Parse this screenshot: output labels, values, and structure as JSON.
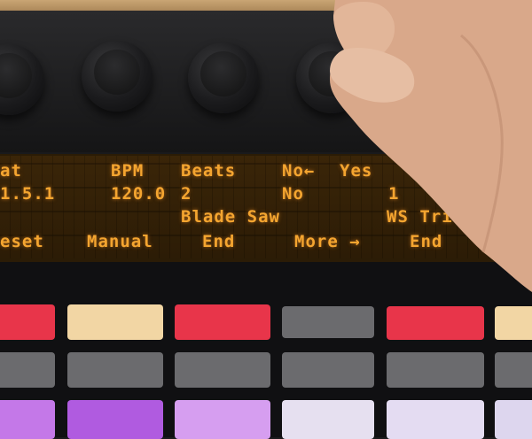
{
  "display": {
    "row1": {
      "c1": "at",
      "c2": "BPM",
      "c3": "Beats",
      "c4": "No←",
      "c5": "Yes"
    },
    "row2": {
      "c1": "1.5.1",
      "c2": "120.0",
      "c3": "2",
      "c4": "No",
      "c5": "1"
    },
    "row3": {
      "c3": "Blade Saw",
      "c5": "WS Tri"
    },
    "row4": {
      "c1": "eset",
      "c2": "Manual",
      "c3": "End",
      "c4": "More →",
      "c5": "End"
    }
  },
  "colors": {
    "lcd_text": "#f4a530",
    "pad_red": "#e8354a",
    "pad_cream": "#f2d6a4",
    "pad_grey": "#6b6b6e",
    "pad_purple": "#c478e8"
  }
}
